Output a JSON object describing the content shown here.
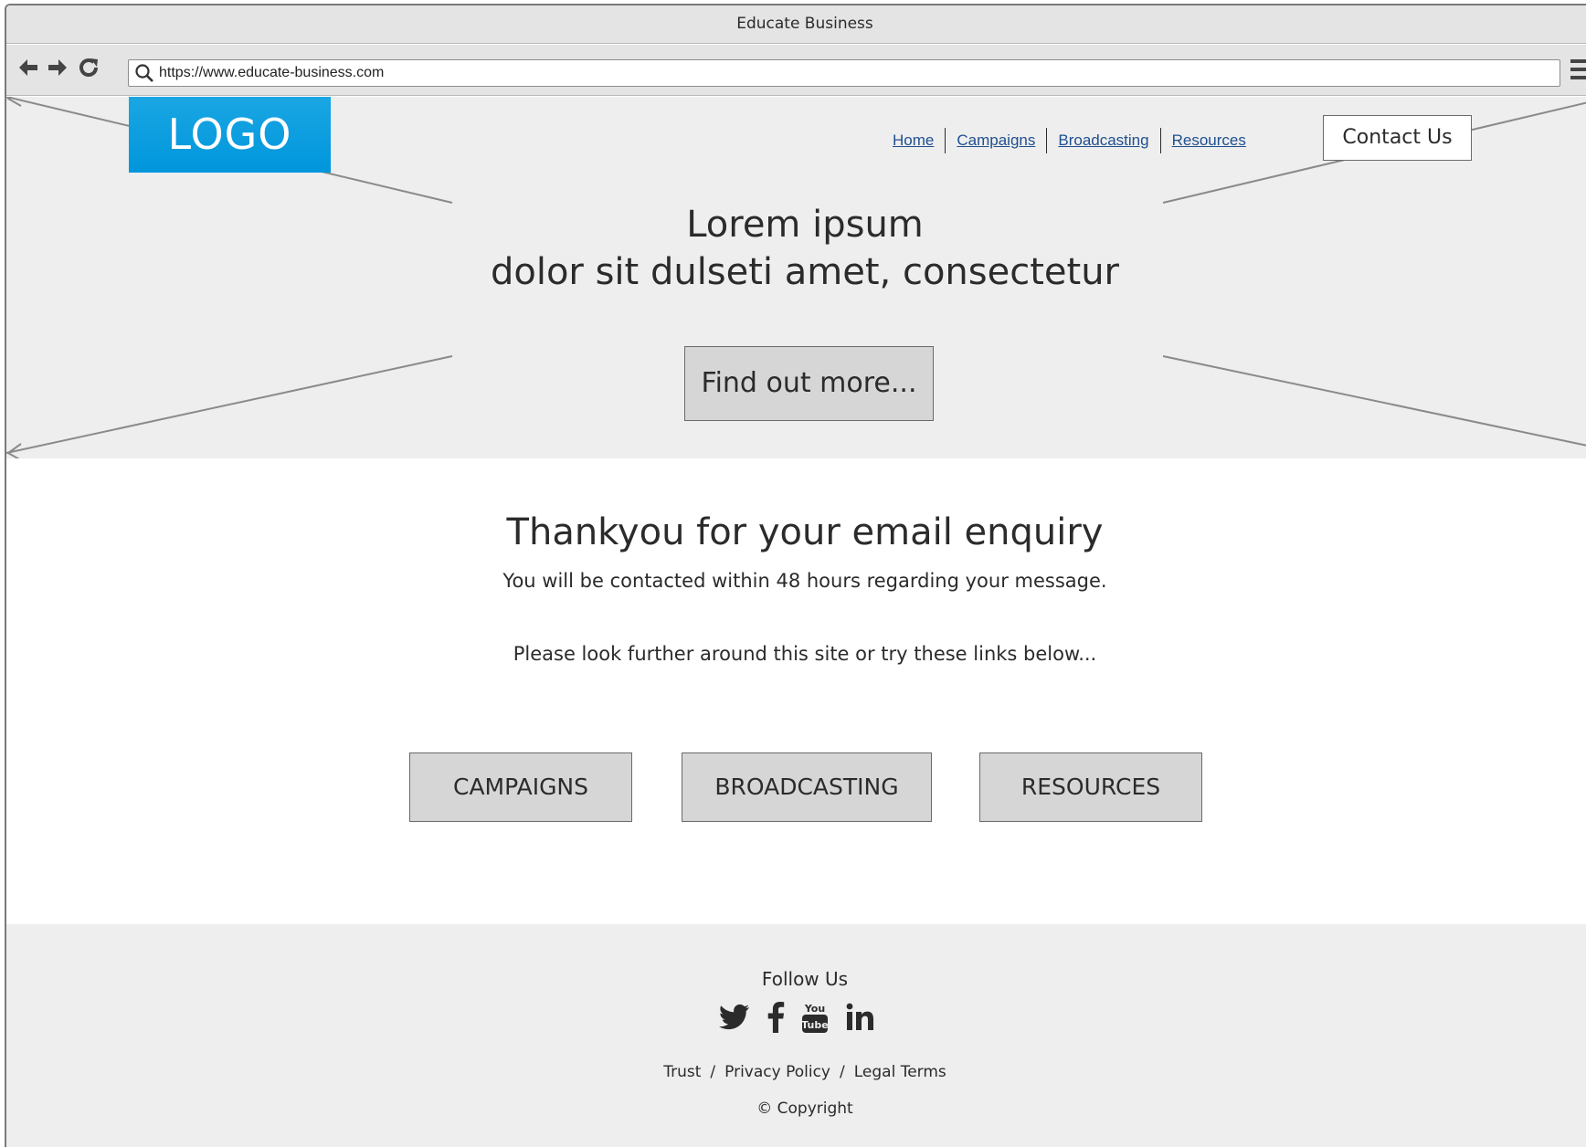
{
  "window": {
    "title": "Educate Business"
  },
  "toolbar": {
    "back_icon": "arrow-left",
    "forward_icon": "arrow-right",
    "reload_icon": "reload",
    "url": "https://www.educate-business.com",
    "menu_icon": "hamburger"
  },
  "header": {
    "logo_text": "LOGO",
    "logo_color": "#0096dc",
    "nav": [
      "Home",
      "Campaigns",
      "Broadcasting",
      "Resources"
    ],
    "contact_label": "Contact Us"
  },
  "hero": {
    "title_line1": "Lorem ipsum",
    "title_line2": "dolor sit dulseti amet, consectetur",
    "button_label": "Find out more..."
  },
  "main": {
    "heading": "Thankyou for your email enquiry",
    "line1": "You will be contacted within 48 hours regarding your message.",
    "line2": "Please look further around this site or try these links below...",
    "buttons": [
      "CAMPAIGNS",
      "BROADCASTING",
      "RESOURCES"
    ]
  },
  "footer": {
    "follow_label": "Follow Us",
    "social_icons": [
      "twitter-icon",
      "facebook-icon",
      "youtube-icon",
      "linkedin-icon"
    ],
    "links": [
      "Trust",
      "Privacy Policy",
      "Legal Terms"
    ],
    "copyright_symbol": "©",
    "copyright_text": "Copyright"
  }
}
